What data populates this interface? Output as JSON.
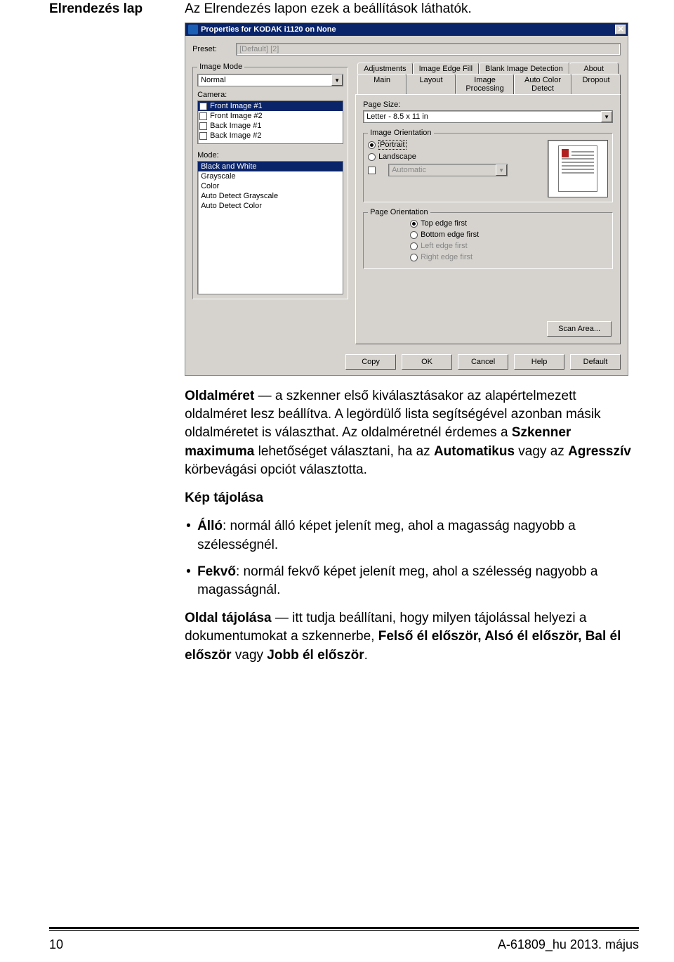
{
  "heading_left": "Elrendezés lap",
  "intro": "Az Elrendezés lapon ezek a beállítások láthatók.",
  "dialog": {
    "title": "Properties for KODAK i1120 on None",
    "close": "✕",
    "preset_label": "Preset:",
    "preset_value": "[Default] [2]",
    "image_mode": {
      "legend": "Image Mode",
      "normal": "Normal",
      "camera_label": "Camera:",
      "camera_items": [
        {
          "label": "Front Image #1",
          "checked": true,
          "selected": true
        },
        {
          "label": "Front Image #2",
          "checked": false,
          "selected": false
        },
        {
          "label": "Back Image #1",
          "checked": false,
          "selected": false
        },
        {
          "label": "Back Image #2",
          "checked": false,
          "selected": false
        }
      ],
      "mode_label": "Mode:",
      "mode_items": [
        {
          "label": "Black and White",
          "selected": true
        },
        {
          "label": "Grayscale",
          "selected": false
        },
        {
          "label": "Color",
          "selected": false
        },
        {
          "label": "Auto Detect Grayscale",
          "selected": false
        },
        {
          "label": "Auto Detect Color",
          "selected": false
        }
      ]
    },
    "tabs_top": [
      "Adjustments",
      "Image Edge Fill",
      "Blank Image Detection",
      "About"
    ],
    "tabs_bottom": [
      "Main",
      "Layout",
      "Image Processing",
      "Auto Color Detect",
      "Dropout"
    ],
    "active_tab": "Layout",
    "page_size_label": "Page Size:",
    "page_size_value": "Letter - 8.5 x 11 in",
    "img_orient": {
      "legend": "Image Orientation",
      "portrait": "Portrait",
      "landscape": "Landscape",
      "automatic": "Automatic"
    },
    "page_orient": {
      "legend": "Page Orientation",
      "top": "Top edge first",
      "bottom": "Bottom edge first",
      "left": "Left edge first",
      "right": "Right edge first"
    },
    "scan_area_btn": "Scan Area...",
    "buttons": {
      "copy": "Copy",
      "ok": "OK",
      "cancel": "Cancel",
      "help": "Help",
      "def": "Default"
    }
  },
  "body": {
    "p1_a": "Oldalméret",
    "p1_b": " — a szkenner első kiválasztásakor az alapértelmezett oldalméret lesz beállítva. A legördülő lista segítségével azonban másik oldalméretet is választhat. Az oldalméretnél érdemes a ",
    "p1_c": "Szkenner maximuma",
    "p1_d": " lehetőséget választani, ha az ",
    "p1_e": "Automatikus",
    "p1_f": " vagy az ",
    "p1_g": "Agresszív",
    "p1_h": " körbevágási opciót választotta.",
    "p2": "Kép tájolása",
    "b1_a": "Álló",
    "b1_b": ": normál álló képet jelenít meg, ahol a magasság nagyobb a szélességnél.",
    "b2_a": "Fekvő",
    "b2_b": ": normál fekvő képet jelenít meg, ahol a szélesség nagyobb a magasságnál.",
    "p3_a": "Oldal tájolása",
    "p3_b": " — itt tudja beállítani, hogy milyen tájolással helyezi a dokumentumokat a szkennerbe, ",
    "p3_c": "Felső él először, Alsó él először, Bal él először",
    "p3_d": " vagy ",
    "p3_e": "Jobb él először",
    "p3_f": "."
  },
  "footer": {
    "page": "10",
    "doc": "A-61809_hu  2013. május"
  }
}
